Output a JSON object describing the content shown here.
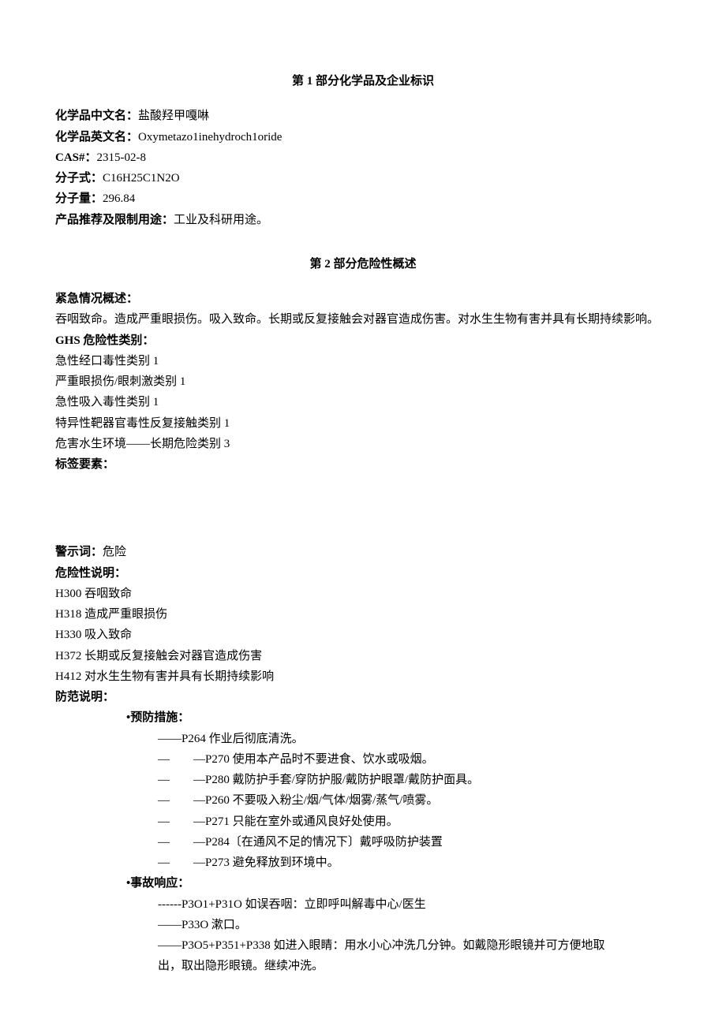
{
  "section1": {
    "title": "第 1 部分化学品及企业标识",
    "fields": {
      "cn_name_label": "化学品中文名：",
      "cn_name_value": "盐酸羟甲嘎啉",
      "en_name_label": "化学品英文名：",
      "en_name_value": "Oxymetazo1inehydroch1oride",
      "cas_label": "CAS#：",
      "cas_value": "2315-02-8",
      "formula_label": "分子式：",
      "formula_value": "C16H25C1N2O",
      "mw_label": "分子量：",
      "mw_value": "296.84",
      "usage_label": "产品推荐及限制用途：",
      "usage_value": "工业及科研用途。"
    }
  },
  "section2": {
    "title": "第 2 部分危险性概述",
    "emergency_label": "紧急情况概述：",
    "emergency_text": "吞咽致命。造成严重眼损伤。吸入致命。长期或反复接触会对器官造成伤害。对水生生物有害并具有长期持续影响。",
    "ghs_label": "GHS 危险性类别：",
    "ghs_items": [
      "急性经口毒性类别 1",
      "严重眼损伤/眼刺激类别 1",
      "急性吸入毒性类别 1",
      "特异性靶器官毒性反复接触类别 1",
      "危害水生环境——长期危险类别 3"
    ],
    "label_elements": "标签要素：",
    "signal_label": "警示词：",
    "signal_value": "危险",
    "hazard_label": "危险性说明：",
    "hazard_items": [
      "H300 吞咽致命",
      "H318 造成严重眼损伤",
      "H330 吸入致命",
      "H372 长期或反复接触会对器官造成伤害",
      "H412 对水生生物有害并具有长期持续影响"
    ],
    "precaution_label": "防范说明：",
    "prevention_label": "•预防措施：",
    "prevention_items": [
      "——P264 作业后彻底清洗。",
      "—　　—P270 使用本产品时不要进食、饮水或吸烟。",
      "—　　—P280 戴防护手套/穿防护服/戴防护眼罩/戴防护面具。",
      "—　　—P260 不要吸入粉尘/烟/气体/烟雾/蒸气/喷雾。",
      "—　　—P271 只能在室外或通风良好处使用。",
      "—　　—P284〔在通风不足的情况下〕戴呼吸防护装置",
      "—　　—P273 避免释放到环境中。"
    ],
    "response_label": "•事故响应：",
    "response_items": [
      "------P3O1+P31O 如误吞咽：立即呼叫解毒中心/医生",
      "——P33O 漱口。",
      "——P3O5+P351+P338 如进入眼睛：用水小心冲洗几分钟。如戴隐形眼镜并可方便地取",
      "出，取出隐形眼镜。继续冲洗。"
    ]
  }
}
